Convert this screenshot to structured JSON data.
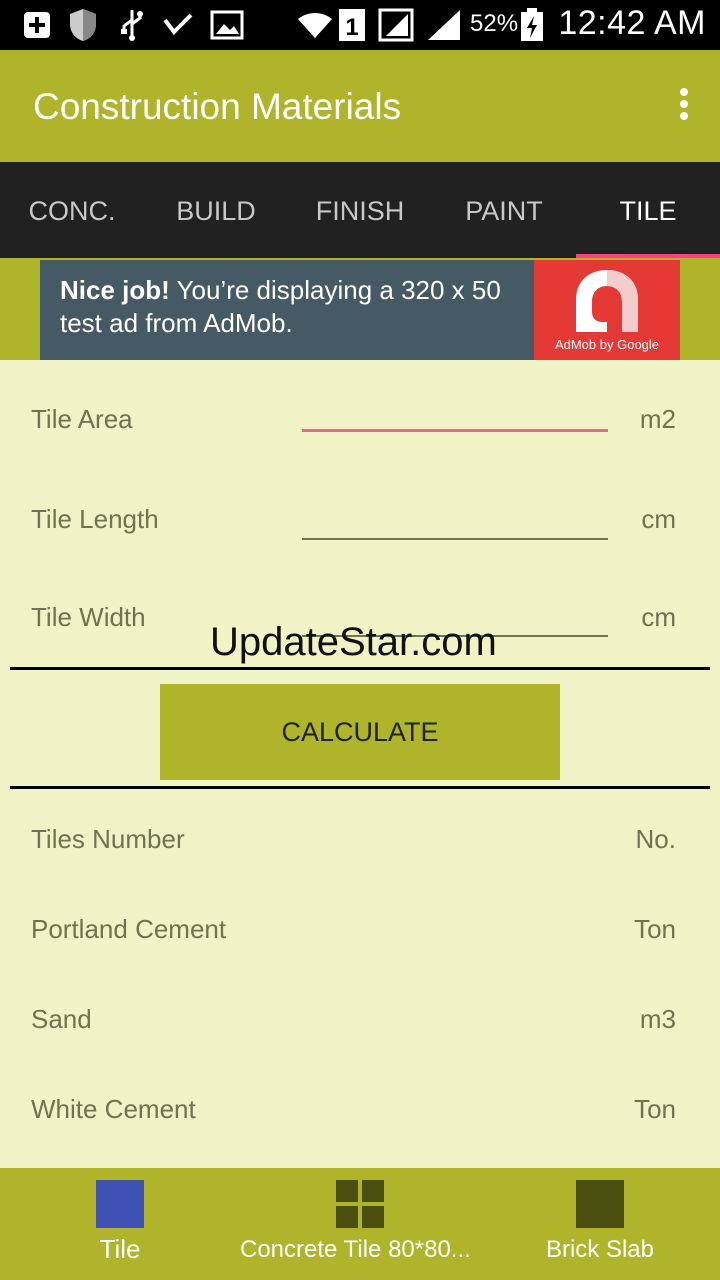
{
  "status_bar": {
    "battery_percent": "52%",
    "time": "12:42 AM",
    "sim_slot": "1",
    "icons": [
      "add-box-icon",
      "shield-icon",
      "usb-icon",
      "check-signal-icon",
      "image-icon",
      "wifi-icon",
      "sim-icon",
      "signal-icon",
      "signal-icon",
      "battery-icon"
    ]
  },
  "app_bar": {
    "title": "Construction Materials",
    "overflow_icon": "more-vert-icon"
  },
  "tabs": [
    {
      "label": "CONC."
    },
    {
      "label": "BUILD"
    },
    {
      "label": "FINISH"
    },
    {
      "label": "PAINT"
    },
    {
      "label": "TILE"
    }
  ],
  "active_tab": "TILE",
  "ad": {
    "headline": "Nice job!",
    "body": " You’re displaying a 320 x 50 test ad from AdMob.",
    "brand": "AdMob by Google"
  },
  "inputs": [
    {
      "label": "Tile Area",
      "unit": "m2",
      "value": "",
      "focused": true
    },
    {
      "label": "Tile Length",
      "unit": "cm",
      "value": ""
    },
    {
      "label": "Tile Width",
      "unit": "cm",
      "value": ""
    }
  ],
  "watermark": "UpdateStar.com",
  "calculate_label": "CALCULATE",
  "results": [
    {
      "label": "Tiles Number",
      "unit": "No."
    },
    {
      "label": "Portland Cement",
      "unit": "Ton"
    },
    {
      "label": "Sand",
      "unit": "m3"
    },
    {
      "label": "White Cement",
      "unit": "Ton"
    }
  ],
  "bottom_nav": [
    {
      "label": "Tile",
      "icon": "square-icon",
      "color": "#3f51b5"
    },
    {
      "label": "Concrete Tile 80*80...",
      "icon": "grid-icon",
      "color": "#4a4f10"
    },
    {
      "label": "Brick Slab",
      "icon": "slab-icon",
      "color": "#4a4f10"
    }
  ],
  "colors": {
    "primary": "#afb42b",
    "accent": "#ff4081",
    "tab_bar": "#212121",
    "background": "#f0f3c6"
  }
}
